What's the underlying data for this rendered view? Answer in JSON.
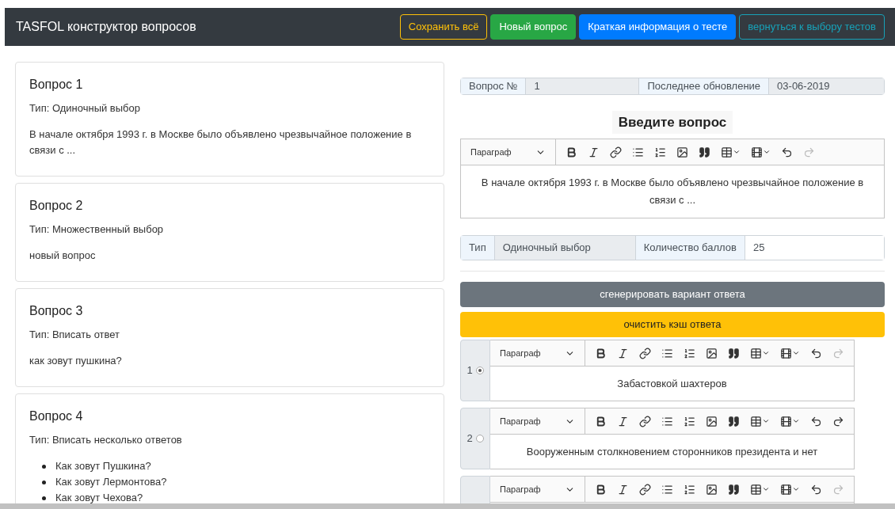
{
  "navbar": {
    "title": "TASFOL конструктор вопросов",
    "buttons": [
      {
        "label": "Сохранить всё",
        "kind": "outline-warning"
      },
      {
        "label": "Новый вопрос",
        "kind": "success"
      },
      {
        "label": "Краткая информация о тесте",
        "kind": "primary"
      },
      {
        "label": "вернуться к выбору тестов",
        "kind": "outline-info"
      }
    ]
  },
  "questions": [
    {
      "title": "Вопрос 1",
      "type": "Тип: Одиночный выбор",
      "text": "В начале октября 1993 г. в Москве было объявлено чрезвычайное положение в связи с ..."
    },
    {
      "title": "Вопрос 2",
      "type": "Тип: Множественный выбор",
      "text": "новый вопрос"
    },
    {
      "title": "Вопрос 3",
      "type": "Тип: Вписать ответ",
      "text": "как зовут пушкина?"
    },
    {
      "title": "Вопрос 4",
      "type": "Тип: Вписать несколько ответов",
      "items": [
        "Как зовут Пушкина?",
        "Как зовут Лермонтова?",
        "Как зовут Чехова?"
      ]
    }
  ],
  "editor": {
    "number_label": "Вопрос №",
    "number": "1",
    "updated_label": "Последнее обновление",
    "updated": "03-06-2019",
    "heading": "Введите вопрос",
    "format": "Параграф",
    "redo_enabled": false,
    "content": "В начале октября 1993 г. в Москве было объявлено чрезвычайное положение в связи с ...",
    "type_label": "Тип",
    "type": "Одиночный выбор",
    "points_label": "Количество баллов",
    "points": "25"
  },
  "generate_button": "сгенерировать вариант ответа",
  "clear_button": "очистить кэш ответа",
  "answers": [
    {
      "number": "1",
      "selected": true,
      "format": "Параграф",
      "redo_enabled": false,
      "text": "Забастовкой шахтеров"
    },
    {
      "number": "2",
      "selected": false,
      "format": "Параграф",
      "redo_enabled": true,
      "text": "Вооруженным столкновением сторонников президента и нет"
    },
    {
      "format": "Параграф",
      "redo_enabled": false
    }
  ]
}
